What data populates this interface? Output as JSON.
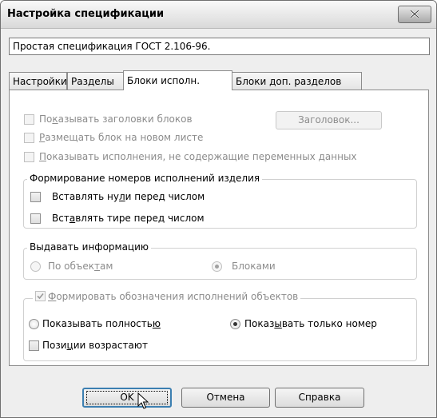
{
  "window": {
    "title": "Настройка спецификации"
  },
  "spec_field": {
    "value": "Простая спецификация ГОСТ 2.106-96."
  },
  "tabs": [
    {
      "label": "Настройки",
      "active": false
    },
    {
      "label": "Разделы",
      "active": false
    },
    {
      "label": "Блоки исполн.",
      "active": true
    },
    {
      "label": "Блоки доп. разделов",
      "active": false
    }
  ],
  "blocks": {
    "show_headers": {
      "pre": "По",
      "u": "к",
      "post": "азывать заголовки блоков",
      "checked": false,
      "enabled": false
    },
    "header_button": "Заголовок...",
    "new_sheet": {
      "pre": "",
      "u": "Р",
      "post": "азмещать блок на новом листе",
      "checked": false,
      "enabled": false
    },
    "show_variants": {
      "pre": "",
      "u": "П",
      "post": "оказывать исполнения, не содержащие переменных данных",
      "checked": false,
      "enabled": false
    }
  },
  "numbering": {
    "title": "Формирование номеров исполнений изделия",
    "zeros": {
      "pre": "Вставлять ну",
      "u": "л",
      "post": "и перед числом",
      "checked": false
    },
    "dash": {
      "pre": "Вст",
      "u": "а",
      "post": "влять тире перед числом",
      "checked": false
    }
  },
  "output": {
    "title": "Выдавать информацию",
    "by_objects": {
      "pre": "По объек",
      "u": "т",
      "post": "ам",
      "selected": false
    },
    "by_blocks": {
      "label": "Блоками",
      "selected": true
    }
  },
  "designations": {
    "checkbox": {
      "pre": "",
      "u": "Ф",
      "post": "ормировать обозначения исполнений объектов",
      "checked": true
    },
    "full": {
      "pre": "Показывать полность",
      "u": "ю",
      "post": "",
      "selected": false
    },
    "number_only": {
      "pre": "Показ",
      "u": "ы",
      "post": "вать только номер",
      "selected": true
    },
    "ascending": {
      "pre": "Пози",
      "u": "ц",
      "post": "ии возрастают",
      "checked": false
    }
  },
  "buttons": {
    "ok": "OK",
    "cancel": "Отмена",
    "help": "Справка"
  },
  "icons": {
    "close": "close-icon",
    "cursor": "mouse-pointer-icon"
  },
  "colors": {
    "focus_border": "#3c7fb1"
  }
}
